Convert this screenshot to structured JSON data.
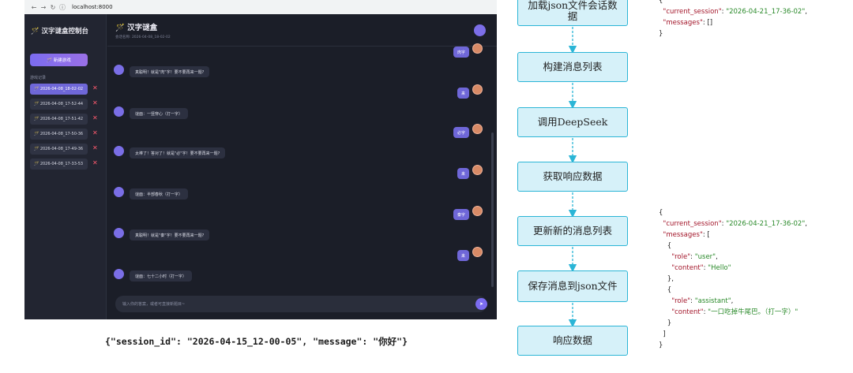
{
  "browser": {
    "url": "localhost:8000",
    "sidebar": {
      "title": "🪄 汉字谜盒控制台",
      "new_game": "🪄 新建游戏",
      "section_label": "游戏记录",
      "sessions": [
        {
          "label": "🪄 2026-04-08_18-02-02",
          "active": true
        },
        {
          "label": "🪄 2026-04-08_17-52-44",
          "active": false
        },
        {
          "label": "🪄 2026-04-08_17-51-42",
          "active": false
        },
        {
          "label": "🪄 2026-04-08_17-50-36",
          "active": false
        },
        {
          "label": "🪄 2026-04-08_17-49-36",
          "active": false
        },
        {
          "label": "🪄 2026-04-08_17-33-53",
          "active": false
        }
      ],
      "delete_glyph": "✕"
    },
    "chat": {
      "title": "🪄 汉字谜盒",
      "subtitle": "会话名称: 2026-04-08_18-02-02",
      "messages": [
        {
          "role": "user",
          "text": "肉字"
        },
        {
          "role": "bot",
          "text": "真聪明！就是\"肉\"字！要不要再来一题?"
        },
        {
          "role": "user",
          "text": "来"
        },
        {
          "role": "bot",
          "text": "谜面：一竖穿心（打一字）"
        },
        {
          "role": "user",
          "text": "必字"
        },
        {
          "role": "bot",
          "text": "太棒了！答对了！就是\"必\"字！要不要再来一题?"
        },
        {
          "role": "user",
          "text": "来"
        },
        {
          "role": "bot",
          "text": "谜面：半部春秋（打一字）"
        },
        {
          "role": "user",
          "text": "秦字"
        },
        {
          "role": "bot",
          "text": "真聪明！就是\"秦\"字！要不要再来一题?"
        },
        {
          "role": "user",
          "text": "来"
        },
        {
          "role": "bot",
          "text": "谜面：七十二小时（打一字）"
        }
      ],
      "input_placeholder": "输入你的答案，或者可直接新题目~",
      "send_glyph": "➤"
    }
  },
  "request_json": "{\"session_id\": \"2026-04-15_12-00-05\", \"message\": \"你好\"}",
  "flow": {
    "nodes": [
      "加载json文件会话数据",
      "构建消息列表",
      "调用DeepSeek",
      "获取响应数据",
      "更新新的消息列表",
      "保存消息到json文件",
      "响应数据"
    ],
    "colors": {
      "fill": "#d6f1f9",
      "border": "#2bb5d6"
    }
  },
  "code_top": {
    "open": "{",
    "current_session_key": "\"current_session\"",
    "current_session_val": "\"2026-04-21_17-36-02\"",
    "messages_key": "\"messages\"",
    "messages_val": "[]",
    "close": "}"
  },
  "code_bottom": {
    "open": "{",
    "current_session_key": "\"current_session\"",
    "current_session_val": "\"2026-04-21_17-36-02\"",
    "messages_key": "\"messages\"",
    "messages": [
      {
        "role_key": "\"role\"",
        "role_val": "\"user\"",
        "content_key": "\"content\"",
        "content_val": "\"Hello\""
      },
      {
        "role_key": "\"role\"",
        "role_val": "\"assistant\"",
        "content_key": "\"content\"",
        "content_val": "\"一口吃掉牛尾巴。（打一字）\""
      }
    ],
    "close": "}"
  }
}
